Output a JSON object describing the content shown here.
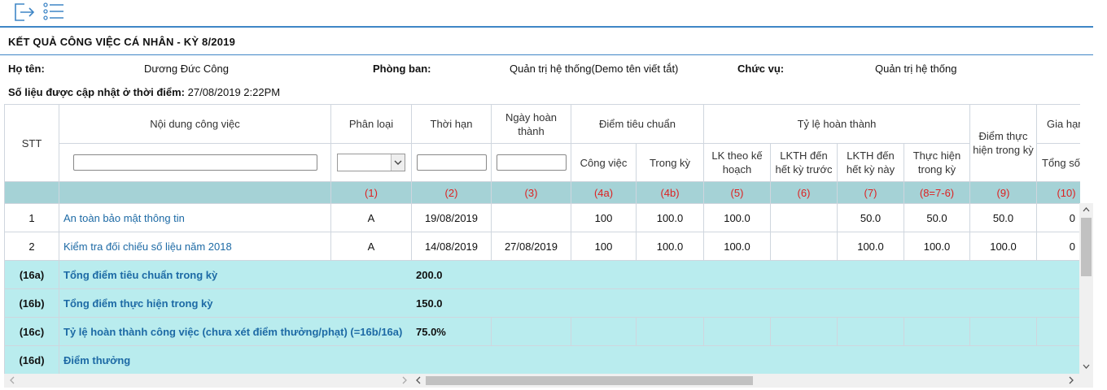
{
  "toolbar": {
    "icons": [
      "exit-icon",
      "list-icon"
    ]
  },
  "page": {
    "title": "KẾT QUẢ CÔNG VIỆC CÁ NHÂN - KỲ 8/2019"
  },
  "info": {
    "name_label": "Họ tên:",
    "name_value": "Dương Đức Công",
    "dept_label": "Phòng ban:",
    "dept_value": "Quản trị hệ thống(Demo tên viết tắt)",
    "position_label": "Chức vụ:",
    "position_value": "Quản trị hệ thống",
    "updated_label": "Số liệu được cập nhật ở thời điểm:",
    "updated_value": "27/08/2019 2:22PM"
  },
  "table": {
    "headers": {
      "stt": "STT",
      "content": "Nội dung công việc",
      "category": "Phân loại",
      "deadline": "Thời hạn",
      "done_date": "Ngày hoàn thành",
      "standard_points": "Điểm tiêu chuẩn",
      "standard_task": "Công việc",
      "standard_period": "Trong kỳ",
      "completion_rate": "Tỷ lệ hoàn thành",
      "lk_plan": "LK theo kế hoạch",
      "lkth_prev": "LKTH đến hết kỳ trước",
      "lkth_this": "LKTH đến hết kỳ này",
      "actual_period": "Thực hiện trong kỳ",
      "points_done": "Điểm thực hiện trong kỳ",
      "extension": "Gia hạn",
      "extension_total": "Tổng số lầ"
    },
    "column_numbers": [
      "(1)",
      "(2)",
      "(3)",
      "(4a)",
      "(4b)",
      "(5)",
      "(6)",
      "(7)",
      "(8=7-6)",
      "(9)",
      "(10)"
    ],
    "filters": {
      "content": "",
      "category": "",
      "deadline": "",
      "done_date": ""
    },
    "rows": [
      {
        "stt": "1",
        "content": "An toàn bảo mật thông tin",
        "category": "A",
        "deadline": "19/08/2019",
        "done_date": "",
        "std_task": "100",
        "std_period": "100.0",
        "lk_plan": "100.0",
        "lkth_prev": "",
        "lkth_this": "50.0",
        "actual": "50.0",
        "points": "50.0",
        "ext_total": "0"
      },
      {
        "stt": "2",
        "content": "Kiểm tra đối chiếu số liệu năm 2018",
        "category": "A",
        "deadline": "14/08/2019",
        "done_date": "27/08/2019",
        "std_task": "100",
        "std_period": "100.0",
        "lk_plan": "100.0",
        "lkth_prev": "",
        "lkth_this": "100.0",
        "actual": "100.0",
        "points": "100.0",
        "ext_total": "0"
      }
    ],
    "summary": [
      {
        "code": "(16a)",
        "label": "Tổng điểm tiêu chuẩn trong kỳ",
        "value": "200.0"
      },
      {
        "code": "(16b)",
        "label": "Tổng điểm thực hiện trong kỳ",
        "value": "150.0"
      },
      {
        "code": "(16c)",
        "label": "Tỷ lệ hoàn thành công việc (chưa xét điểm thưởng/phạt) (=16b/16a)",
        "value": "75.0%"
      },
      {
        "code": "(16d)",
        "label": "Điểm thưởng",
        "value": ""
      }
    ]
  },
  "colors": {
    "accent": "#3f86c6",
    "header_band": "#a5d2d6",
    "summary_band": "#b9ecee",
    "link": "#1d6aa5",
    "column_number": "#dd2222"
  }
}
